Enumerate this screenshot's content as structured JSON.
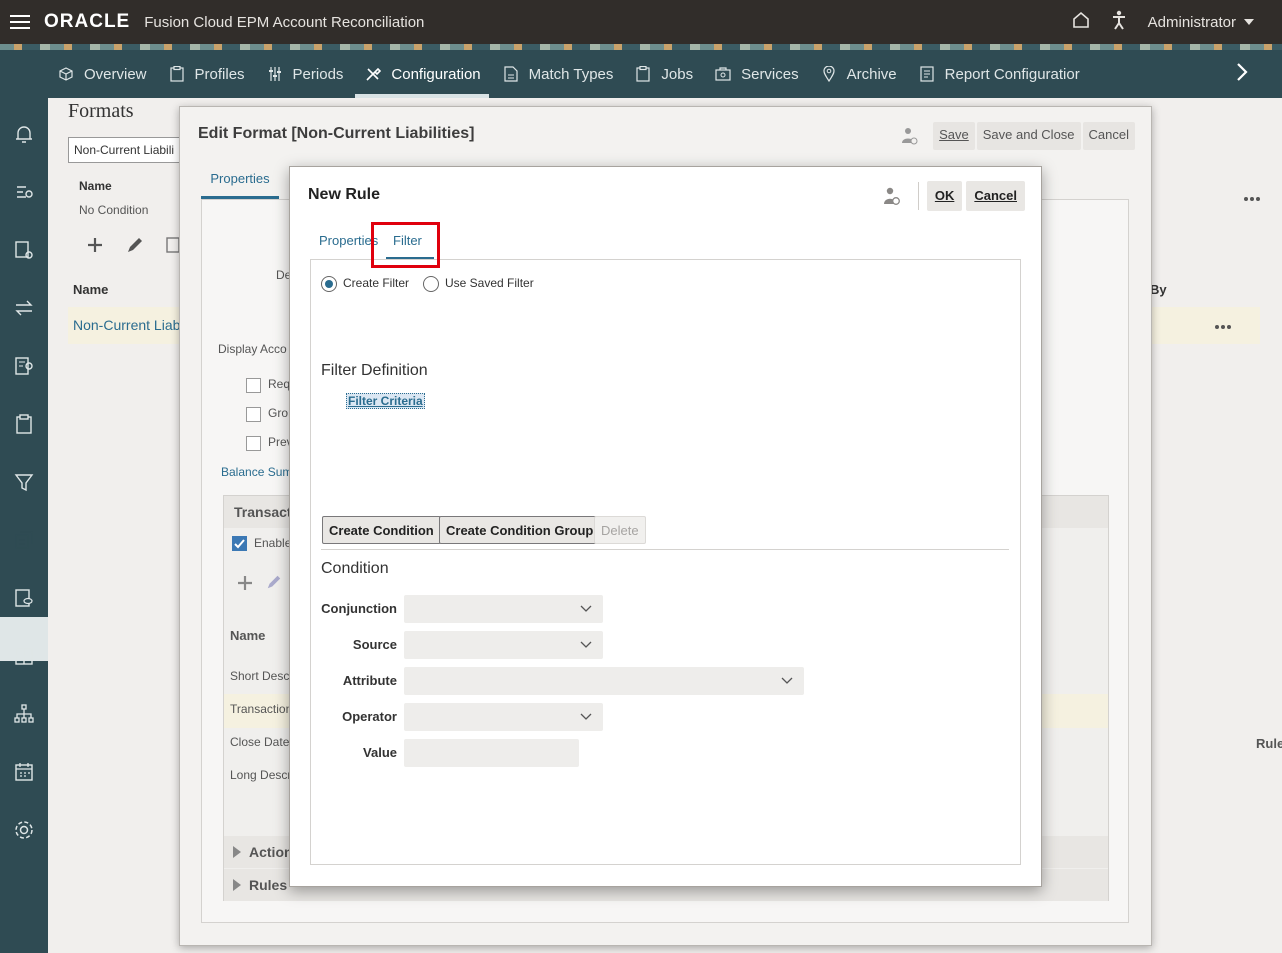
{
  "header": {
    "brand": "ORACLE",
    "app_title": "Fusion Cloud EPM Account Reconciliation",
    "user": "Administrator"
  },
  "nav": {
    "items": [
      {
        "label": "Overview",
        "icon": "cube-icon"
      },
      {
        "label": "Profiles",
        "icon": "clipboard-icon"
      },
      {
        "label": "Periods",
        "icon": "sliders-icon"
      },
      {
        "label": "Configuration",
        "icon": "tools-icon",
        "active": true
      },
      {
        "label": "Match Types",
        "icon": "document-icon"
      },
      {
        "label": "Jobs",
        "icon": "clipboard-icon"
      },
      {
        "label": "Services",
        "icon": "briefcase-icon"
      },
      {
        "label": "Archive",
        "icon": "pin-icon"
      },
      {
        "label": "Report Configuratior",
        "icon": "report-icon"
      }
    ]
  },
  "background": {
    "page_title": "Formats",
    "search_value": "Non-Current Liabili",
    "name_col": "Name",
    "no_condition": "No Condition",
    "list_name_header": "Name",
    "list_item": "Non-Current Liab",
    "by_col": "By",
    "rules_col": "Rules",
    "display_acc": "Display Acco",
    "de_label": "De",
    "req": "Req",
    "gro": "Gro",
    "prev": "Prev",
    "balance_sum": "Balance Sum",
    "transact": "Transact",
    "enable": "Enable",
    "name2": "Name",
    "short_desc": "Short Desc",
    "transaction": "Transaction",
    "close_date": "Close Date",
    "long_desc": "Long Descr",
    "action": "Action",
    "rules": "Rules"
  },
  "edit_dialog": {
    "title": "Edit Format [Non-Current Liabilities]",
    "save": "Save",
    "save_close": "Save and Close",
    "cancel": "Cancel",
    "tab_properties": "Properties"
  },
  "rule_dialog": {
    "title": "New Rule",
    "ok": "OK",
    "cancel": "Cancel",
    "tabs": {
      "properties": "Properties",
      "filter": "Filter"
    },
    "radio_create": "Create Filter",
    "radio_saved": "Use Saved Filter",
    "filter_definition": "Filter Definition",
    "filter_criteria": "Filter Criteria",
    "buttons": {
      "create_condition": "Create Condition",
      "create_group": "Create Condition Group",
      "delete": "Delete"
    },
    "condition_heading": "Condition",
    "fields": {
      "conjunction": "Conjunction",
      "source": "Source",
      "attribute": "Attribute",
      "operator": "Operator",
      "value": "Value"
    }
  },
  "colors": {
    "header_bg": "#312d2a",
    "nav_bg": "#2f4b53",
    "accent": "#2a6c8f",
    "highlight": "#e0000d"
  }
}
